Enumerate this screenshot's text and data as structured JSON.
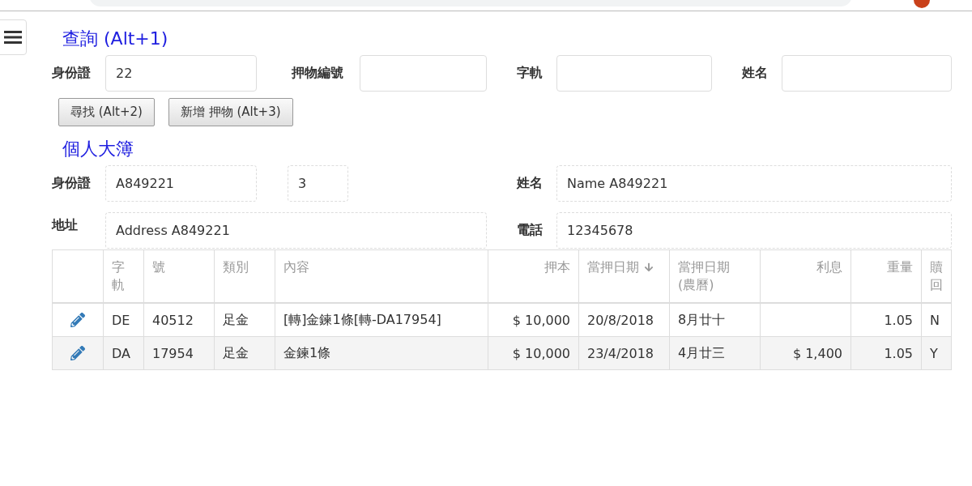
{
  "search": {
    "title": "查詢 (Alt+1)",
    "fields": [
      {
        "label": "身份證",
        "value": "22"
      },
      {
        "label": "押物編號"
      },
      {
        "label": "字軌"
      },
      {
        "label": "姓名"
      }
    ],
    "buttons": [
      "尋找 (Alt+2)",
      "新增 押物 (Alt+3)"
    ]
  },
  "ledger": {
    "title": "個人大簿",
    "fields": [
      {
        "label": "身份證",
        "value": "A849221"
      },
      {
        "value": "3"
      },
      {
        "label": "姓名",
        "value": "Name A849221"
      },
      {
        "label": "地址",
        "value": "Address A849221"
      },
      {
        "label": "電話",
        "value": "12345678"
      }
    ]
  },
  "table": {
    "columns": [
      {
        "label": "字軌",
        "sorted": false
      },
      {
        "label": "號",
        "sorted": false
      },
      {
        "label": "類別",
        "sorted": false
      },
      {
        "label": "內容",
        "sorted": false
      },
      {
        "label": "押本",
        "sorted": false
      },
      {
        "label": "當押日期",
        "sorted": true
      },
      {
        "label": "當押日期 (農曆)",
        "sorted": false
      },
      {
        "label": "利息",
        "sorted": false
      },
      {
        "label": "重量",
        "sorted": false
      },
      {
        "label": "贖回",
        "sorted": false
      }
    ],
    "rows": [
      {
        "cells": [
          "DE",
          "40512",
          "足金",
          "[轉]金鍊1條[轉-DA17954]",
          "$ 10,000",
          "20/8/2018",
          "8月廿十",
          null,
          "1.05",
          "N"
        ]
      },
      {
        "cells": [
          "DA",
          "17954",
          "足金",
          "金鍊1條",
          "$ 10,000",
          "23/4/2018",
          "4月廿三",
          "$ 1,400",
          "1.05",
          "Y"
        ]
      }
    ]
  }
}
